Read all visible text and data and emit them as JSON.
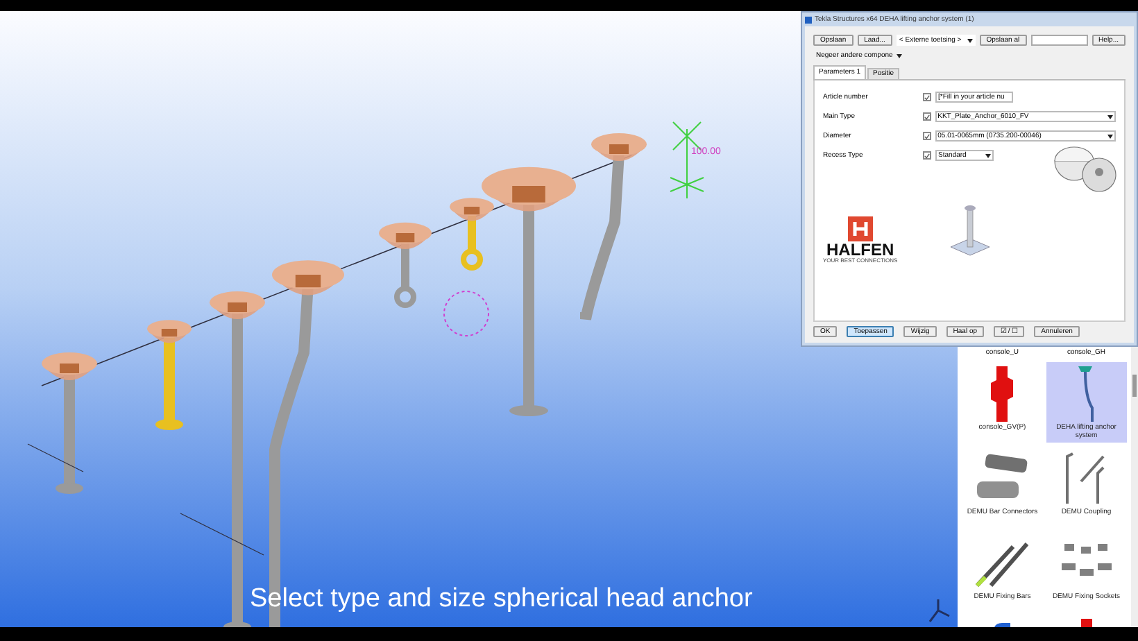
{
  "viewport": {
    "dimension_label": "100.00",
    "caption": "Select type and size spherical head anchor"
  },
  "dialog": {
    "title": "Tekla Structures x64  DEHA lifting anchor system (1)",
    "toolbar": {
      "save": "Opslaan",
      "load": "Laad...",
      "preset": "< Externe toetsing >",
      "save_as": "Opslaan al",
      "help": "Help...",
      "filter": "Negeer andere compone"
    },
    "tabs": [
      {
        "label": "Parameters 1",
        "selected": true
      },
      {
        "label": "Positie",
        "selected": false
      }
    ],
    "fields": [
      {
        "label": "Article number",
        "checked": true,
        "kind": "text",
        "value": "[*Fill in your article nu"
      },
      {
        "label": "Main Type",
        "checked": true,
        "kind": "select",
        "value": "KKT_Plate_Anchor_6010_FV"
      },
      {
        "label": "Diameter",
        "checked": true,
        "kind": "select",
        "value": "05.01-0065mm (0735.200-00046)"
      },
      {
        "label": "Recess Type",
        "checked": true,
        "kind": "short-select",
        "value": "Standard"
      }
    ],
    "logo": {
      "name": "HALFEN",
      "tagline": "YOUR BEST CONNECTIONS"
    },
    "buttons": [
      {
        "label": "OK",
        "selected": false
      },
      {
        "label": "Toepassen",
        "selected": true
      },
      {
        "label": "Wijzig",
        "selected": false
      },
      {
        "label": "Haal op",
        "selected": false
      },
      {
        "label": "☑ / ☐",
        "selected": false
      },
      {
        "label": "Annuleren",
        "selected": false
      }
    ]
  },
  "catalog": {
    "items": [
      {
        "label": "console_U",
        "selected": false,
        "kind": "cut"
      },
      {
        "label": "console_GH",
        "selected": false,
        "kind": "cut"
      },
      {
        "label": "console_GV(P)",
        "selected": false,
        "kind": "console"
      },
      {
        "label": "DEHA lifting anchor system",
        "selected": true,
        "kind": "anchor"
      },
      {
        "label": "DEMU Bar Connectors",
        "selected": false,
        "kind": "connector"
      },
      {
        "label": "DEMU Coupling",
        "selected": false,
        "kind": "coupling"
      },
      {
        "label": "DEMU Fixing Bars",
        "selected": false,
        "kind": "bars"
      },
      {
        "label": "DEMU Fixing Sockets",
        "selected": false,
        "kind": "sockets"
      },
      {
        "selected": false,
        "kind": "pipe"
      },
      {
        "selected": false,
        "kind": "console"
      }
    ]
  }
}
